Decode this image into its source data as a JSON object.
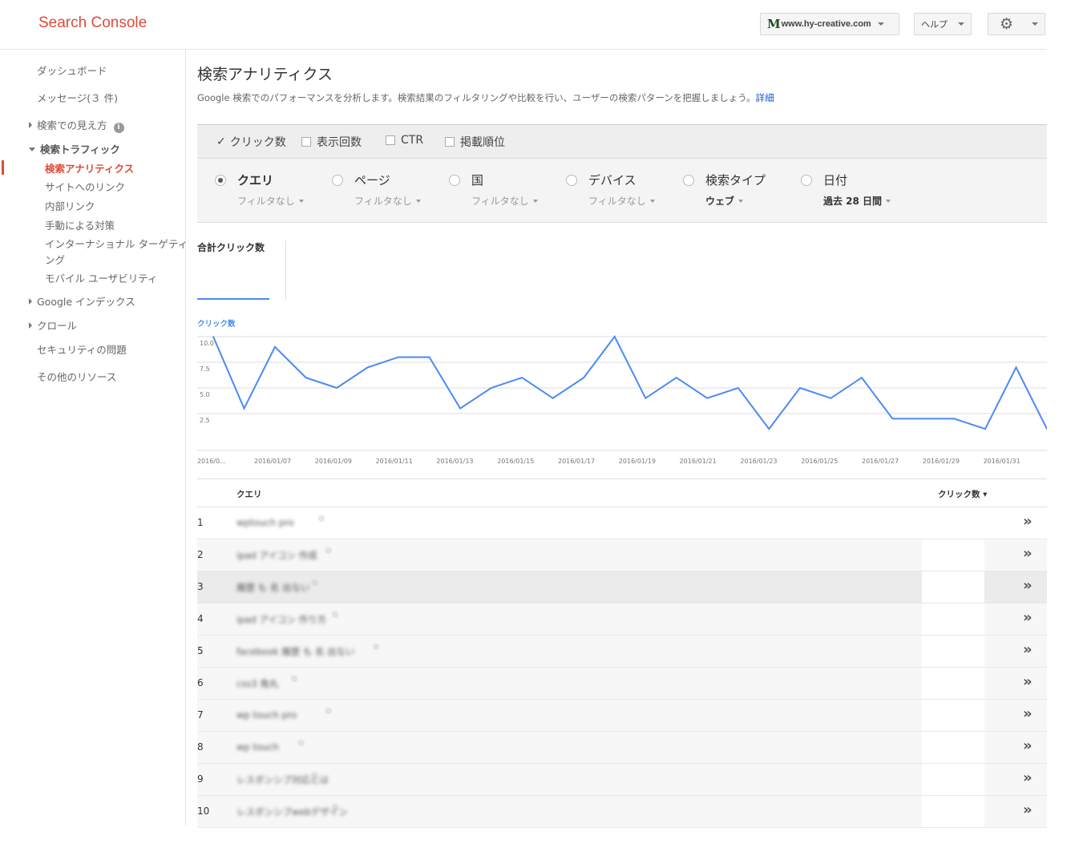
{
  "header": {
    "app_title": "Search Console",
    "site_logo": "M",
    "site": "www.hy-creative.com",
    "help": "ヘルプ",
    "gear_icon": "gear-icon"
  },
  "sidebar": {
    "dashboard": "ダッシュボード",
    "messages": "メッセージ(３ 件)",
    "search_appearance": "検索での見え方",
    "search_traffic": "検索トラフィック",
    "sub": [
      "検索アナリティクス",
      "サイトへのリンク",
      "内部リンク",
      "手動による対策",
      "インターナショナル ターゲティ",
      "ング",
      "モバイル ユーザビリティ"
    ],
    "google_index": "Google インデックス",
    "crawl": "クロール",
    "security": "セキュリティの問題",
    "other": "その他のリソース",
    "accent": "#dd4b39"
  },
  "main": {
    "title": "検索アナリティクス",
    "description": "Google 検索でのパフォーマンスを分析します。検索結果のフィルタリングや比較を行い、ユーザーの検索パターンを把握しましょう。",
    "details_link": "詳細",
    "metrics": [
      {
        "label": "クリック数",
        "checked": true
      },
      {
        "label": "表示回数",
        "checked": false
      },
      {
        "label": "CTR",
        "checked": false
      },
      {
        "label": "掲載順位",
        "checked": false
      }
    ],
    "dimensions": [
      {
        "label": "クエリ",
        "filter": "フィルタなし",
        "selected": true
      },
      {
        "label": "ページ",
        "filter": "フィルタなし",
        "selected": false
      },
      {
        "label": "国",
        "filter": "フィルタなし",
        "selected": false
      },
      {
        "label": "デバイス",
        "filter": "フィルタなし",
        "selected": false
      },
      {
        "label": "検索タイプ",
        "filter": "ウェブ",
        "selected": false
      },
      {
        "label": "日付",
        "filter": "過去 28 日間",
        "selected": false
      }
    ],
    "total_clicks_label": "合計クリック数"
  },
  "chart_data": {
    "type": "line",
    "series": [
      {
        "name": "クリック数",
        "values": [
          10,
          3,
          9,
          6,
          5,
          7,
          8,
          8,
          3,
          5,
          6,
          4,
          6,
          10,
          4,
          6,
          4,
          5,
          1,
          5,
          4,
          6,
          2,
          2,
          2,
          1,
          7,
          1
        ]
      }
    ],
    "y_ticks": [
      "10.0",
      "7.5",
      "5.0",
      "2.5"
    ],
    "ylim": [
      0,
      10
    ],
    "x_tick_labels": [
      "2016/0...",
      "2016/01/07",
      "2016/01/09",
      "2016/01/11",
      "2016/01/13",
      "2016/01/15",
      "2016/01/17",
      "2016/01/19",
      "2016/01/21",
      "2016/01/23",
      "2016/01/25",
      "2016/01/27",
      "2016/01/29",
      "2016/01/31"
    ],
    "grid": true,
    "color": "#4a8af4"
  },
  "table": {
    "col_query": "クエリ",
    "col_clicks": "クリック数 ▾",
    "rows": [
      {
        "n": "1",
        "query": "wptouch pro"
      },
      {
        "n": "2",
        "query": "ipad アイコン 作成"
      },
      {
        "n": "3",
        "query": "履歴 も 名 出ない"
      },
      {
        "n": "4",
        "query": "ipad アイコン 作り方"
      },
      {
        "n": "5",
        "query": "facebook 履歴 も 名 出ない"
      },
      {
        "n": "6",
        "query": "css3 角丸"
      },
      {
        "n": "7",
        "query": "wp touch pro"
      },
      {
        "n": "8",
        "query": "wp touch"
      },
      {
        "n": "9",
        "query": "レスポンシブ対応とは"
      },
      {
        "n": "10",
        "query": "レスポンシブwebデザイン"
      }
    ],
    "go_icon": "double-chevron-right-icon"
  }
}
